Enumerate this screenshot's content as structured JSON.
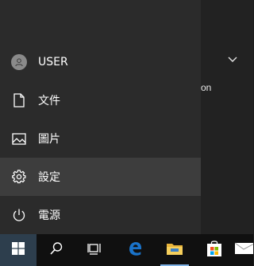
{
  "start_menu": {
    "items": [
      {
        "id": "user",
        "label": "USER",
        "icon": "user-avatar-icon"
      },
      {
        "id": "documents",
        "label": "文件",
        "icon": "document-icon"
      },
      {
        "id": "pictures",
        "label": "圖片",
        "icon": "pictures-icon"
      },
      {
        "id": "settings",
        "label": "設定",
        "icon": "gear-icon",
        "highlighted": true
      },
      {
        "id": "power",
        "label": "電源",
        "icon": "power-icon"
      }
    ]
  },
  "tiles_area": {
    "partial_text": "on",
    "expand_icon": "chevron-down-icon"
  },
  "taskbar": {
    "buttons": [
      {
        "id": "start",
        "icon": "windows-logo-icon",
        "active": true
      },
      {
        "id": "search",
        "icon": "search-icon"
      },
      {
        "id": "task-view",
        "icon": "task-view-icon"
      },
      {
        "id": "edge",
        "icon": "edge-browser-icon"
      },
      {
        "id": "file-explorer",
        "icon": "folder-icon",
        "running": true
      },
      {
        "id": "store",
        "icon": "store-bag-icon"
      },
      {
        "id": "mail",
        "icon": "mail-icon"
      }
    ]
  },
  "colors": {
    "menu_bg": "#2b2b2b",
    "hover_bg": "#3d3d3d",
    "taskbar_bg": "#101010",
    "start_active_bg": "#2d3e4d",
    "running_indicator": "#7fb2e5",
    "edge_blue": "#1a73c9"
  }
}
